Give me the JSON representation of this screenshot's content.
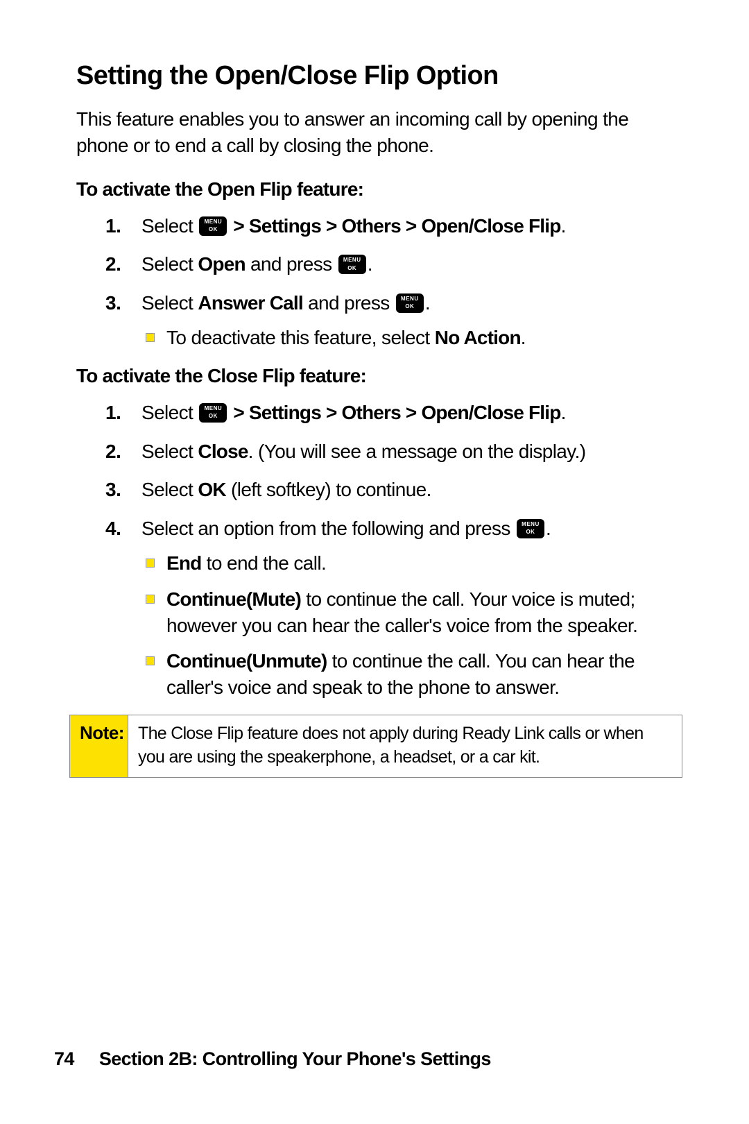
{
  "heading": "Setting the Open/Close Flip Option",
  "intro": "This feature enables you to answer an incoming call by opening the phone or to end a call by closing the phone.",
  "openflip": {
    "subhead": "To activate the Open Flip feature:",
    "step1_a": "Select ",
    "step1_b": " > Settings > Others > Open/Close Flip",
    "step2_a": "Select ",
    "step2_b": "Open",
    "step2_c": " and press ",
    "step3_a": "Select ",
    "step3_b": "Answer Call",
    "step3_c": " and press ",
    "step3_bullet_a": "To deactivate this feature, select ",
    "step3_bullet_b": "No Action",
    "step3_bullet_c": "."
  },
  "closeflip": {
    "subhead": "To activate the Close Flip feature:",
    "step1_a": "Select ",
    "step1_b": " > Settings > Others > Open/Close Flip",
    "step2_a": "Select ",
    "step2_b": "Close",
    "step2_c": ". (You will see a message on the display.)",
    "step3_a": "Select ",
    "step3_b": "OK",
    "step3_c": " (left softkey) to continue.",
    "step4_a": "Select an option from the following and press ",
    "bullets": {
      "end_b": "End",
      "end_t": " to end the call.",
      "mute_b": "Continue(Mute)",
      "mute_t": " to continue the call. Your voice is muted; however you can hear the caller's voice from the speaker.",
      "unmute_b": "Continue(Unmute)",
      "unmute_t": " to continue the call. You can hear the caller's voice and speak to the phone to answer."
    }
  },
  "note": {
    "label": "Note:",
    "text": "The Close Flip feature does not apply during Ready Link calls or when you are using the speakerphone, a headset, or a car kit."
  },
  "footer": {
    "page": "74",
    "section": "Section 2B: Controlling Your Phone's Settings"
  },
  "nums": {
    "n1": "1.",
    "n2": "2.",
    "n3": "3.",
    "n4": "4."
  },
  "period": "."
}
